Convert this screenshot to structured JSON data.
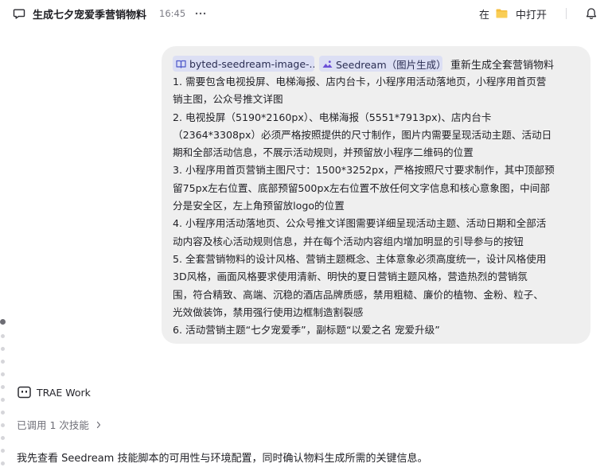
{
  "header": {
    "title": "生成七夕宠爱季营销物料",
    "time": "16:45",
    "open_in_prefix": "在",
    "open_in_action": "中打开",
    "icons": [
      "chat-bubble-icon",
      "more-horizontal-icon",
      "folder-icon",
      "bell-icon"
    ]
  },
  "message": {
    "chips": [
      {
        "label": "byted-seedream-image-...",
        "icon": "book-icon",
        "color": "#dcdff4"
      },
      {
        "label": "Seedream（图片生成）",
        "icon": "image-icon",
        "color": "#dcdff4"
      }
    ],
    "intro": "重新生成全套营销物料",
    "lines": [
      "1. 需要包含电视投屏、电梯海报、店内台卡，小程序用活动落地页，小程序用首页营",
      "销主图，公众号推文详图",
      "2. 电视投屏（5190*2160px）、电梯海报（5551*7913px)、店内台卡",
      "（2364*3308px）必须严格按照提供的尺寸制作，图片内需要呈现活动主题、活动日",
      "期和全部活动信息，不展示活动规则，并预留放小程序二维码的位置",
      "3. 小程序用首页营销主图尺寸：1500*3252px，严格按照尺寸要求制作，其中顶部预",
      "留75px左右位置、底部预留500px左右位置不放任何文字信息和核心意象图，中间部",
      "分是安全区，左上角预留放logo的位置",
      "4. 小程序用活动落地页、公众号推文详图需要详细呈现活动主题、活动日期和全部活",
      "动内容及核心活动规则信息，并在每个活动内容组内增加明显的引导参与的按钮",
      "5. 全套营销物料的设计风格、营销主题概念、主体意象必须高度统一，设计风格使用",
      "3D风格，画面风格要求使用清新、明快的夏日营销主题风格，营造热烈的营销氛",
      "围，符合精致、高端、沉稳的酒店品牌质感，禁用粗糙、廉价的植物、金粉、粒子、",
      "光效做装饰，禁用强行使用边框制造割裂感",
      "6. 活动营销主题“七夕宠爱季”，副标题“以爱之名 宠爱升级”"
    ],
    "bubble_color": "#efefef"
  },
  "agent": {
    "name": "TRAE Work",
    "icon": "trae-logo-icon",
    "skills_used": "已调用 1 次技能",
    "reply": "我先查看 Seedream 技能脚本的可用性与环境配置，同时确认物料生成所需的关键信息。"
  }
}
